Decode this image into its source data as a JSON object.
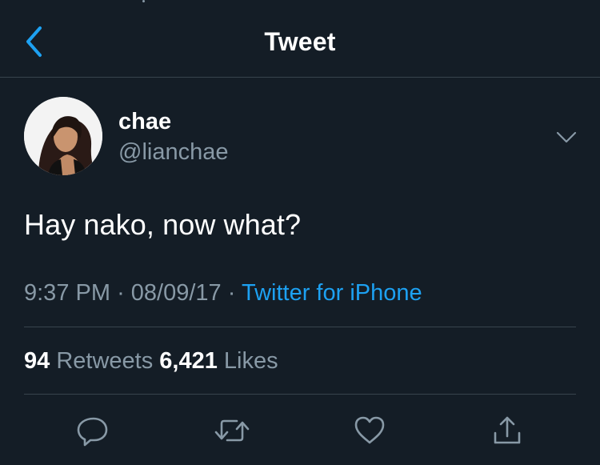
{
  "header": {
    "title": "Tweet",
    "back_icon": "chevron-left-icon"
  },
  "tweet": {
    "author": {
      "name": "chae",
      "handle": "@lianchae"
    },
    "text": "Hay nako, now what?",
    "time": "9:37 PM",
    "date": "08/09/17",
    "source": "Twitter for iPhone",
    "separator": "·",
    "retweets": "94",
    "retweets_label": "Retweets",
    "likes": "6,421",
    "likes_label": "Likes"
  },
  "actions": [
    {
      "name": "reply",
      "icon": "reply-icon"
    },
    {
      "name": "retweet",
      "icon": "retweet-icon"
    },
    {
      "name": "like",
      "icon": "heart-icon"
    },
    {
      "name": "share",
      "icon": "share-icon"
    }
  ],
  "colors": {
    "background": "#141d26",
    "accent": "#1da1f2",
    "secondary_text": "#8899a6",
    "divider": "#38444d",
    "primary_text": "#ffffff"
  }
}
